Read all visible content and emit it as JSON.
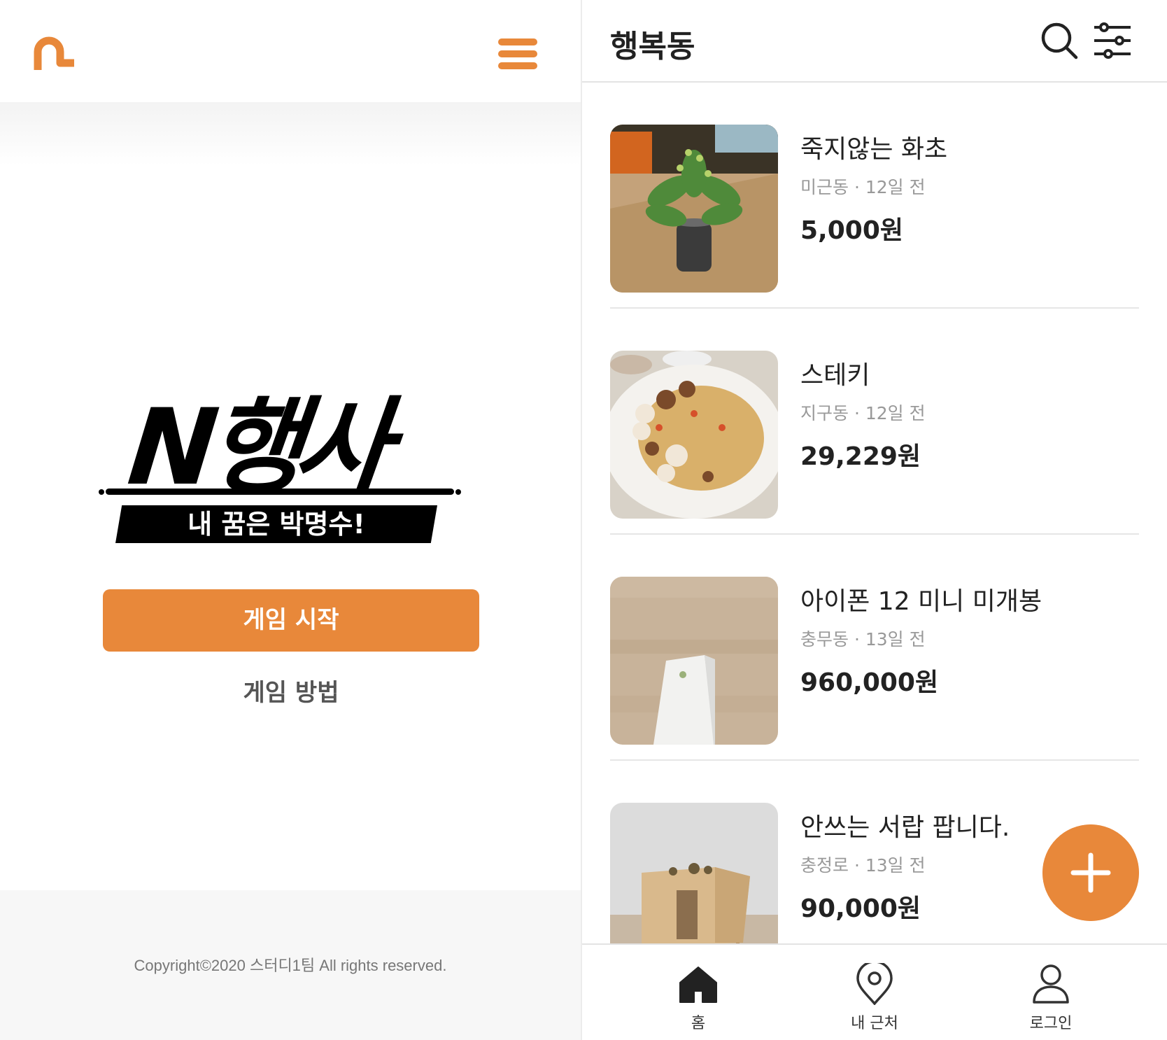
{
  "left": {
    "logo": "n-logo-icon",
    "menu_icon": "hamburger-icon",
    "brand_title": "N행사",
    "brand_tagline": "내 꿈은 박명수!",
    "start_button": "게임 시작",
    "howto_link": "게임 방법",
    "copyright": "Copyright©2020 스터디1팀 All rights reserved."
  },
  "right": {
    "title": "행복동",
    "items": [
      {
        "title": "죽지않는 화초",
        "meta": "미근동 · 12일 전",
        "price": "5,000원"
      },
      {
        "title": "스테키",
        "meta": "지구동 · 12일 전",
        "price": "29,229원"
      },
      {
        "title": "아이폰 12 미니 미개봉",
        "meta": "충무동 · 13일 전",
        "price": "960,000원"
      },
      {
        "title": "안쓰는 서랍 팝니다.",
        "meta": "충정로 · 13일 전",
        "price": "90,000원"
      }
    ],
    "tabs": [
      {
        "label": "홈",
        "icon": "home-icon"
      },
      {
        "label": "내 근처",
        "icon": "location-pin-icon"
      },
      {
        "label": "로그인",
        "icon": "user-icon"
      }
    ]
  },
  "colors": {
    "accent": "#E8883A",
    "text": "#222222",
    "meta": "#999999"
  }
}
